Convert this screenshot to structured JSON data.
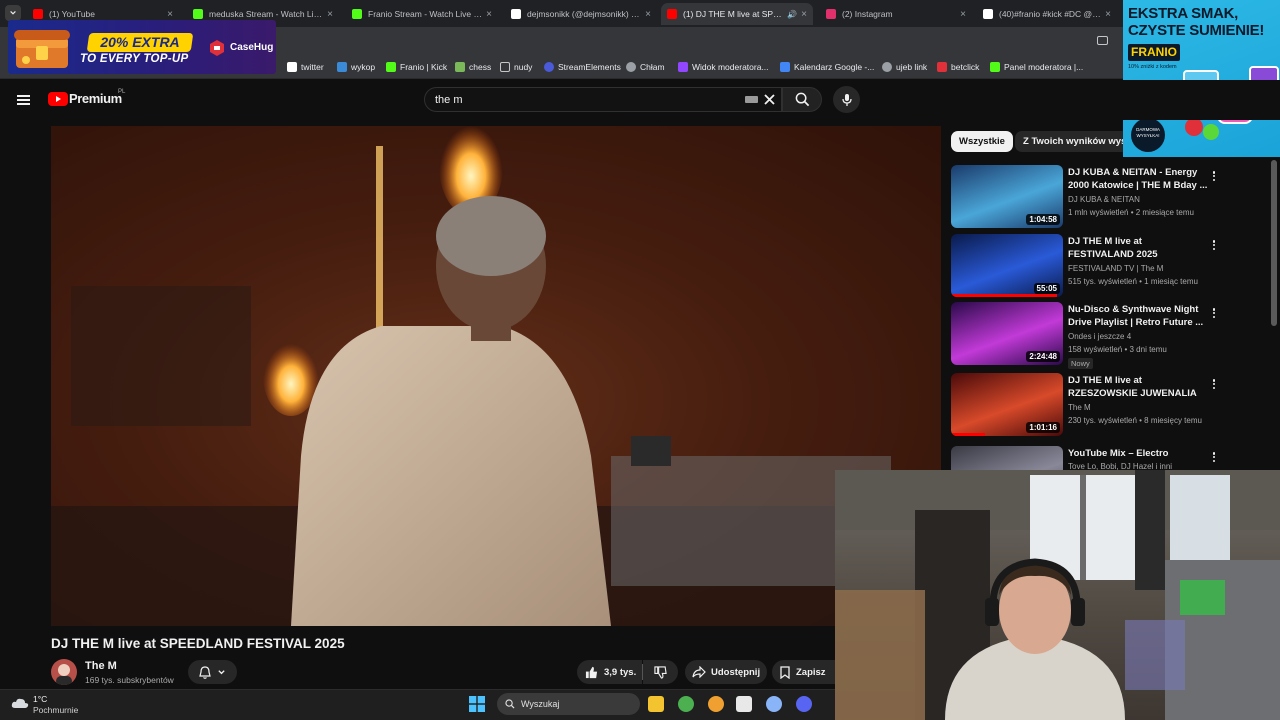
{
  "browser": {
    "tabs": [
      {
        "title": "(1) YouTube",
        "color": "#ff0000"
      },
      {
        "title": "meduska Stream - Watch Live on Kick",
        "color": "#53fc18"
      },
      {
        "title": "Franio Stream - Watch Live on Kick",
        "color": "#53fc18"
      },
      {
        "title": "dejmsonikk (@dejmsonikk) | TikTok",
        "color": "#ffffff"
      },
      {
        "title": "(1) DJ THE M live at SPEEDLAND",
        "color": "#ff0000"
      },
      {
        "title": "(2) Instagram",
        "color": "#e1306c"
      },
      {
        "title": "(40)#franio #kick #DC @franio",
        "color": "#ffffff"
      }
    ],
    "bookmarks": [
      {
        "label": "twitter",
        "icon": "x-icon"
      },
      {
        "label": "wykop",
        "icon": "wykop-icon"
      },
      {
        "label": "Franio | Kick",
        "icon": "kick-icon"
      },
      {
        "label": "chess",
        "icon": "pawn-icon"
      },
      {
        "label": "nudy",
        "icon": "folder-icon"
      },
      {
        "label": "StreamElements",
        "icon": "streamelements-icon"
      },
      {
        "label": "Chłam",
        "icon": "globe-icon"
      },
      {
        "label": "Widok moderatora...",
        "icon": "twitch-icon"
      },
      {
        "label": "Kalendarz Google -...",
        "icon": "calendar-icon"
      },
      {
        "label": "ujeb link",
        "icon": "globe-icon"
      },
      {
        "label": "betclick",
        "icon": "betclick-icon"
      },
      {
        "label": "Panel moderatora |...",
        "icon": "kick-icon"
      }
    ]
  },
  "youtube": {
    "logo_text": "Premium",
    "logo_badge": "PL",
    "search_value": "the m",
    "video_title": "DJ THE M live at SPEEDLAND FESTIVAL 2025",
    "channel_name": "The M",
    "channel_subs": "169 tys. subskrybentów",
    "like_count": "3,9 tys.",
    "share_label": "Udostępnij",
    "save_label": "Zapisz",
    "chips": [
      "Wszystkie",
      "Z Twoich wyników wyszukiwania"
    ],
    "recommendations": [
      {
        "title": "DJ KUBA & NEITAN - Energy 2000 Katowice | THE M Bday ...",
        "channel": "DJ KUBA & NEITAN",
        "meta": "1 mln wyświetleń • 2 miesiące temu",
        "duration": "1:04:58",
        "progress": 0,
        "badge": "",
        "colors": [
          "#1a3a6a",
          "#4aa6d8"
        ]
      },
      {
        "title": "DJ THE M live at FESTIVALAND 2025",
        "channel": "FESTIVALAND TV | The M",
        "meta": "515 tys. wyświetleń • 1 miesiąc temu",
        "duration": "55:05",
        "progress": 0.95,
        "badge": "",
        "colors": [
          "#0a1a4a",
          "#2a5ad8"
        ]
      },
      {
        "title": "Nu-Disco & Synthwave Night Drive Playlist | Retro Future ...",
        "channel": "Ondes i jeszcze 4",
        "meta": "158 wyświetleń • 3 dni temu",
        "duration": "2:24:48",
        "progress": 0,
        "badge": "Nowy",
        "colors": [
          "#2a0a4a",
          "#c23ad8"
        ]
      },
      {
        "title": "DJ THE M live at RZESZOWSKIE JUWENALIA 2025",
        "channel": "The M",
        "meta": "230 tys. wyświetleń • 8 miesięcy temu",
        "duration": "1:01:16",
        "progress": 0.3,
        "badge": "",
        "colors": [
          "#4a0a0a",
          "#d84a2a"
        ]
      },
      {
        "title": "YouTube Mix – Electro",
        "channel": "Tove Lo, Bobi, DJ Hazel i inni",
        "meta": "",
        "duration": "",
        "progress": 0,
        "badge": "",
        "colors": [
          "#3a3a44",
          "#888899"
        ]
      }
    ]
  },
  "ads": {
    "left_percent": "20% EXTRA",
    "left_sub": "TO EVERY TOP-UP",
    "left_brand": "CaseHug",
    "right_line1": "EKSTRA SMAK,",
    "right_line2": "CZYSTE SUMIENIE!",
    "right_brand": "FRANIO",
    "right_tagline": "10% zniżki z kodem",
    "right_stamp": "DARMOWA WYSYŁKA!"
  },
  "taskbar": {
    "temp": "1°C",
    "weather": "Pochmurnie",
    "search_placeholder": "Wyszukaj"
  }
}
